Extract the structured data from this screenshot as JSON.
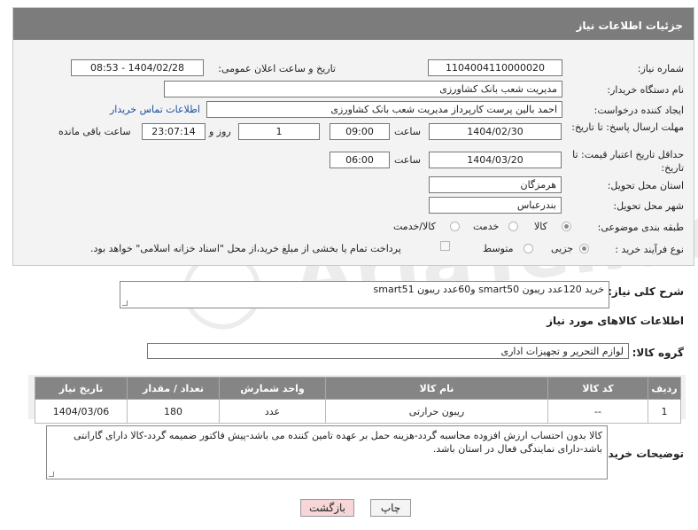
{
  "header": {
    "title": "جزئیات اطلاعات نیاز"
  },
  "form": {
    "need_number": {
      "label": "شماره نیاز:",
      "value": "1104004110000020"
    },
    "announce_date": {
      "label": "تاریخ و ساعت اعلان عمومی:",
      "value": "1404/02/28 - 08:53"
    },
    "buyer_org": {
      "label": "نام دستگاه خریدار:",
      "value": "مدیریت شعب بانک کشاورزی"
    },
    "creator": {
      "label": "ایجاد کننده درخواست:",
      "value": "احمد بالین پرست  کارپرداز مدیریت شعب بانک کشاورزی",
      "link": "اطلاعات تماس خریدار"
    },
    "reply_deadline": {
      "label": "مهلت ارسال پاسخ: تا تاریخ:",
      "date": "1404/02/30",
      "time_label": "ساعت",
      "time": "09:00",
      "days": "1",
      "days_label": "روز و",
      "remaining": "23:07:14",
      "remaining_label": "ساعت باقی مانده"
    },
    "price_validity": {
      "label": "حداقل تاریخ اعتبار قیمت: تا تاریخ:",
      "date": "1404/03/20",
      "time_label": "ساعت",
      "time": "06:00"
    },
    "province": {
      "label": "استان محل تحویل:",
      "value": "هرمزگان"
    },
    "city": {
      "label": "شهر محل تحویل:",
      "value": "بندرعباس"
    },
    "category": {
      "label": "طبقه بندی موضوعی:",
      "options": [
        "کالا",
        "خدمت",
        "کالا/خدمت"
      ],
      "selected": "کالا"
    },
    "process": {
      "label": "نوع فرآیند خرید :",
      "options": [
        "جزیی",
        "متوسط"
      ],
      "selected": "جزیی",
      "note": "پرداخت تمام یا بخشی از مبلغ خرید،از محل \"اسناد خزانه اسلامی\" خواهد بود."
    }
  },
  "description": {
    "label": "شرح کلی نیاز:",
    "value": "خرید 120عدد ریبون smart50 و60عدد ریبون smart51"
  },
  "items_section": {
    "title": "اطلاعات کالاهای مورد نیاز",
    "group_label": "گروه کالا:",
    "group_value": "لوازم التحریر و تجهیزات اداری"
  },
  "table": {
    "headers": [
      "ردیف",
      "کد کالا",
      "نام کالا",
      "واحد شمارش",
      "تعداد / مقدار",
      "تاریخ نیاز"
    ],
    "rows": [
      [
        "1",
        "--",
        "ریبون حرارتی",
        "عدد",
        "180",
        "1404/03/06"
      ]
    ]
  },
  "buyer_notes": {
    "label": "توضیحات خریدار:",
    "value": "کالا بدون احتساب ارزش افزوده محاسبه گردد-هزینه حمل بر عهده تامین کننده می باشد-پیش فاکتور ضمیمه گردد-کالا دارای گارانتی باشد-دارای نمایندگی فعال در استان باشد."
  },
  "buttons": {
    "print": "چاپ",
    "back": "بازگشت"
  },
  "colors": {
    "header_bg": "#7c7c7c",
    "link": "#1a4ea0",
    "back_button_bg": "#f6d6d6"
  }
}
